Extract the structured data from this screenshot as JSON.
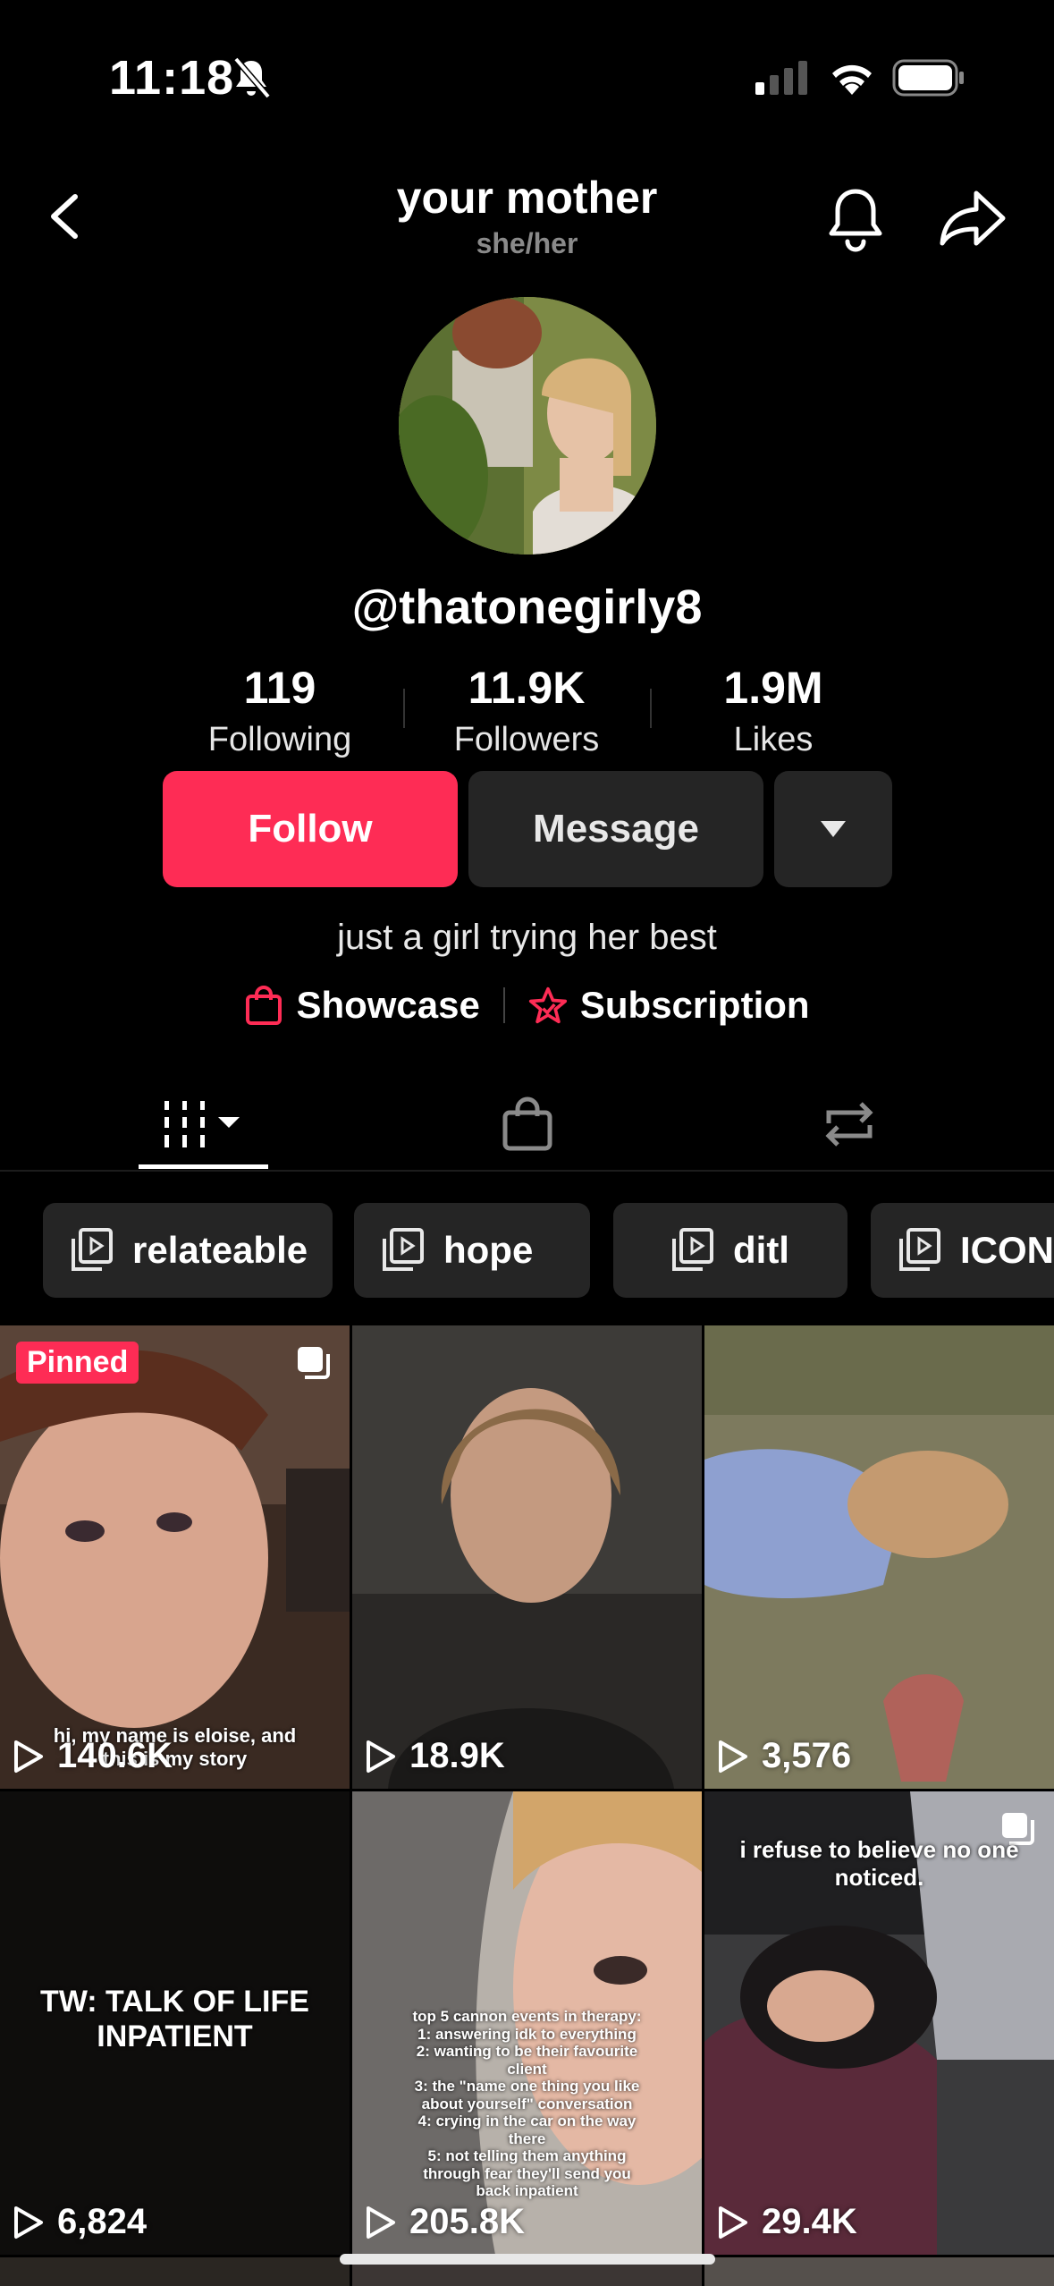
{
  "status_bar": {
    "time": "11:18"
  },
  "header": {
    "title": "your mother",
    "pronouns": "she/her"
  },
  "profile": {
    "username": "@thatonegirly8",
    "bio": "just a girl trying her best"
  },
  "stats": [
    {
      "value": "119",
      "label": "Following"
    },
    {
      "value": "11.9K",
      "label": "Followers"
    },
    {
      "value": "1.9M",
      "label": "Likes"
    }
  ],
  "actions": {
    "follow": "Follow",
    "message": "Message"
  },
  "links": {
    "showcase": "Showcase",
    "subscription": "Subscription"
  },
  "playlists": [
    "relateable",
    "hope",
    "ditl",
    "ICON"
  ],
  "videos": [
    {
      "views": "140.6K",
      "pinned_label": "Pinned",
      "caption": "hi, my name is eloise, and this is my story"
    },
    {
      "views": "18.9K"
    },
    {
      "views": "3,576"
    },
    {
      "views": "6,824",
      "caption": "TW: TALK OF LIFE INPATIENT"
    },
    {
      "views": "205.8K",
      "caption": "top 5 cannon events in therapy:\n1: answering idk to everything\n2: wanting to be their favourite client\n3: the \"name one thing you like about yourself\" conversation\n4: crying in the car on the way there\n5: not telling them anything through fear they'll send you back inpatient"
    },
    {
      "views": "29.4K",
      "caption": "i refuse to believe no one noticed."
    }
  ],
  "colors": {
    "accent": "#fe2c55",
    "button_bg": "#252525",
    "background": "#000000"
  }
}
